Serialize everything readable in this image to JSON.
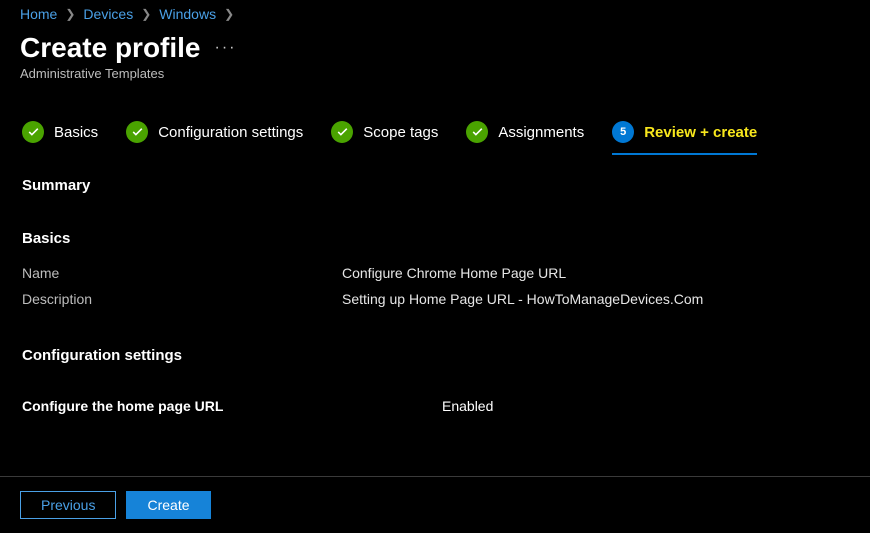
{
  "breadcrumb": {
    "home": "Home",
    "devices": "Devices",
    "windows": "Windows"
  },
  "header": {
    "title": "Create profile",
    "subtitle": "Administrative Templates"
  },
  "steps": {
    "s1": "Basics",
    "s2": "Configuration settings",
    "s3": "Scope tags",
    "s4": "Assignments",
    "s5_num": "5",
    "s5": "Review + create"
  },
  "sections": {
    "summary_head": "Summary",
    "basics_head": "Basics",
    "config_head": "Configuration settings"
  },
  "basics": {
    "name_label": "Name",
    "name_value": "Configure Chrome Home Page URL",
    "desc_label": "Description",
    "desc_value": "Setting up Home Page URL - HowToManageDevices.Com"
  },
  "config": {
    "setting_label": "Configure the home page URL",
    "setting_value": "Enabled"
  },
  "footer": {
    "previous": "Previous",
    "create": "Create"
  }
}
